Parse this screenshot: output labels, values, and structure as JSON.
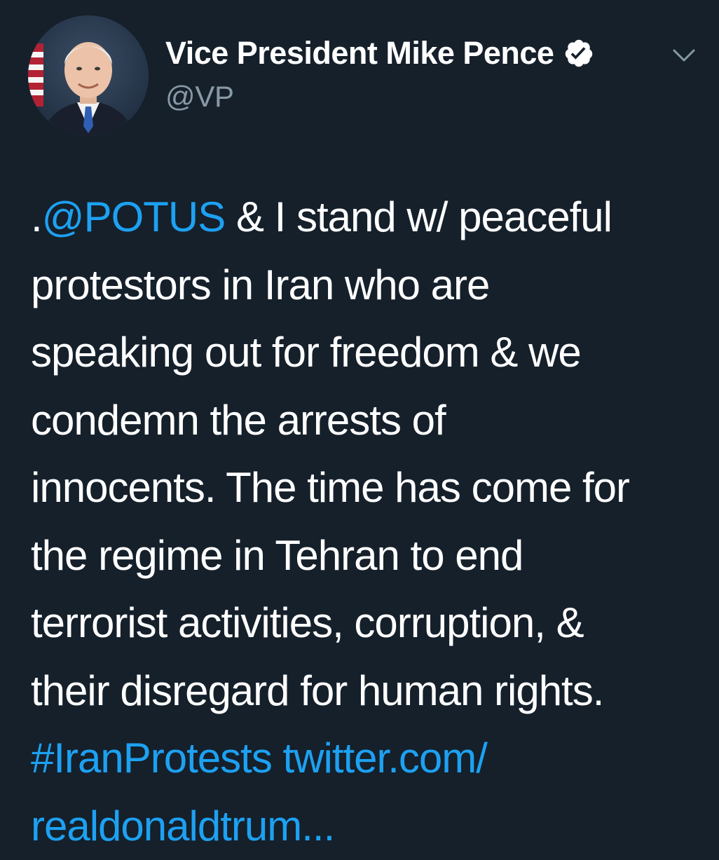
{
  "tweet": {
    "author": {
      "display_name": "Vice President Mike Pence",
      "handle": "@VP",
      "verified": true,
      "avatar_icon": "profile-photo"
    },
    "menu_icon": "chevron-down-icon",
    "body": {
      "line1_prefix": ".",
      "mention": "@POTUS",
      "line1_rest": " & I stand w/ peaceful",
      "line2": "protestors in Iran who are",
      "line3": "speaking out for freedom & we",
      "line4": "condemn the arrests of",
      "line5": "innocents. The time has come for",
      "line6": "the regime in Tehran to end",
      "line7": "terrorist activities, corruption, &",
      "line8": "their disregard for human rights.",
      "hashtag": "#IranProtests",
      "link_part1": "twitter.com/",
      "link_part2": "realdonaldtrum..."
    }
  },
  "colors": {
    "background": "#15202b",
    "text": "#ffffff",
    "secondary_text": "#8899a6",
    "link": "#1da1f2"
  }
}
